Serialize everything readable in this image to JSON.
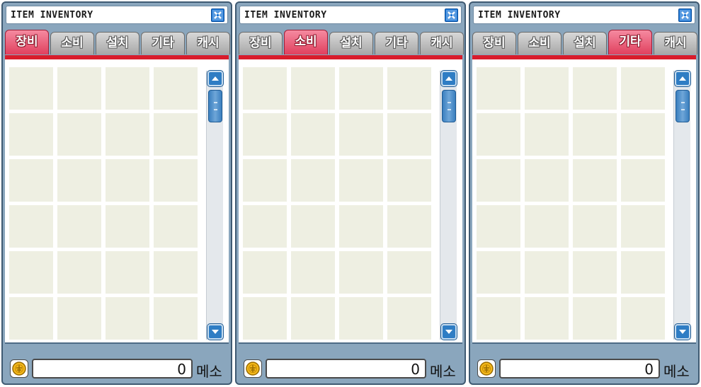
{
  "windows": [
    {
      "title": "ITEM INVENTORY",
      "tabs": [
        {
          "label": "장비",
          "active": true
        },
        {
          "label": "소비",
          "active": false
        },
        {
          "label": "설치",
          "active": false
        },
        {
          "label": "기타",
          "active": false
        },
        {
          "label": "캐시",
          "active": false
        }
      ],
      "meso_value": "0",
      "meso_label": "메소"
    },
    {
      "title": "ITEM INVENTORY",
      "tabs": [
        {
          "label": "장비",
          "active": false
        },
        {
          "label": "소비",
          "active": true
        },
        {
          "label": "설치",
          "active": false
        },
        {
          "label": "기타",
          "active": false
        },
        {
          "label": "캐시",
          "active": false
        }
      ],
      "meso_value": "0",
      "meso_label": "메소"
    },
    {
      "title": "ITEM INVENTORY",
      "tabs": [
        {
          "label": "장비",
          "active": false
        },
        {
          "label": "소비",
          "active": false
        },
        {
          "label": "설치",
          "active": false
        },
        {
          "label": "기타",
          "active": true
        },
        {
          "label": "캐시",
          "active": false
        }
      ],
      "meso_value": "0",
      "meso_label": "메소"
    }
  ],
  "icons": {
    "close": "close-icon",
    "scroll_up": "arrow-up-icon",
    "scroll_down": "arrow-down-icon",
    "meso": "meso-coin-icon"
  },
  "colors": {
    "active_tab": "#e0405e",
    "inactive_tab": "#a7a7a7",
    "tab_underline": "#d91c2b",
    "window_frame": "#8aa6bd",
    "slot": "#eeefe2",
    "scroll_button": "#2f7dc4"
  }
}
